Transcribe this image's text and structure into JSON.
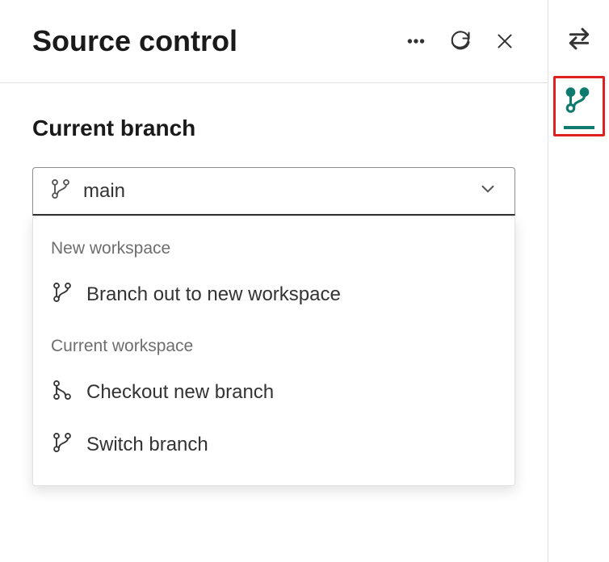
{
  "header": {
    "title": "Source control"
  },
  "section": {
    "label": "Current branch",
    "selected_branch": "main"
  },
  "dropdown": {
    "groups": [
      {
        "label": "New workspace",
        "items": [
          {
            "label": "Branch out to new workspace",
            "icon": "branch-icon"
          }
        ]
      },
      {
        "label": "Current workspace",
        "items": [
          {
            "label": "Checkout new branch",
            "icon": "branch-new-icon"
          },
          {
            "label": "Switch branch",
            "icon": "branch-icon"
          }
        ]
      }
    ]
  },
  "colors": {
    "accent": "#0f7a6e",
    "highlight_border": "#e02020"
  }
}
